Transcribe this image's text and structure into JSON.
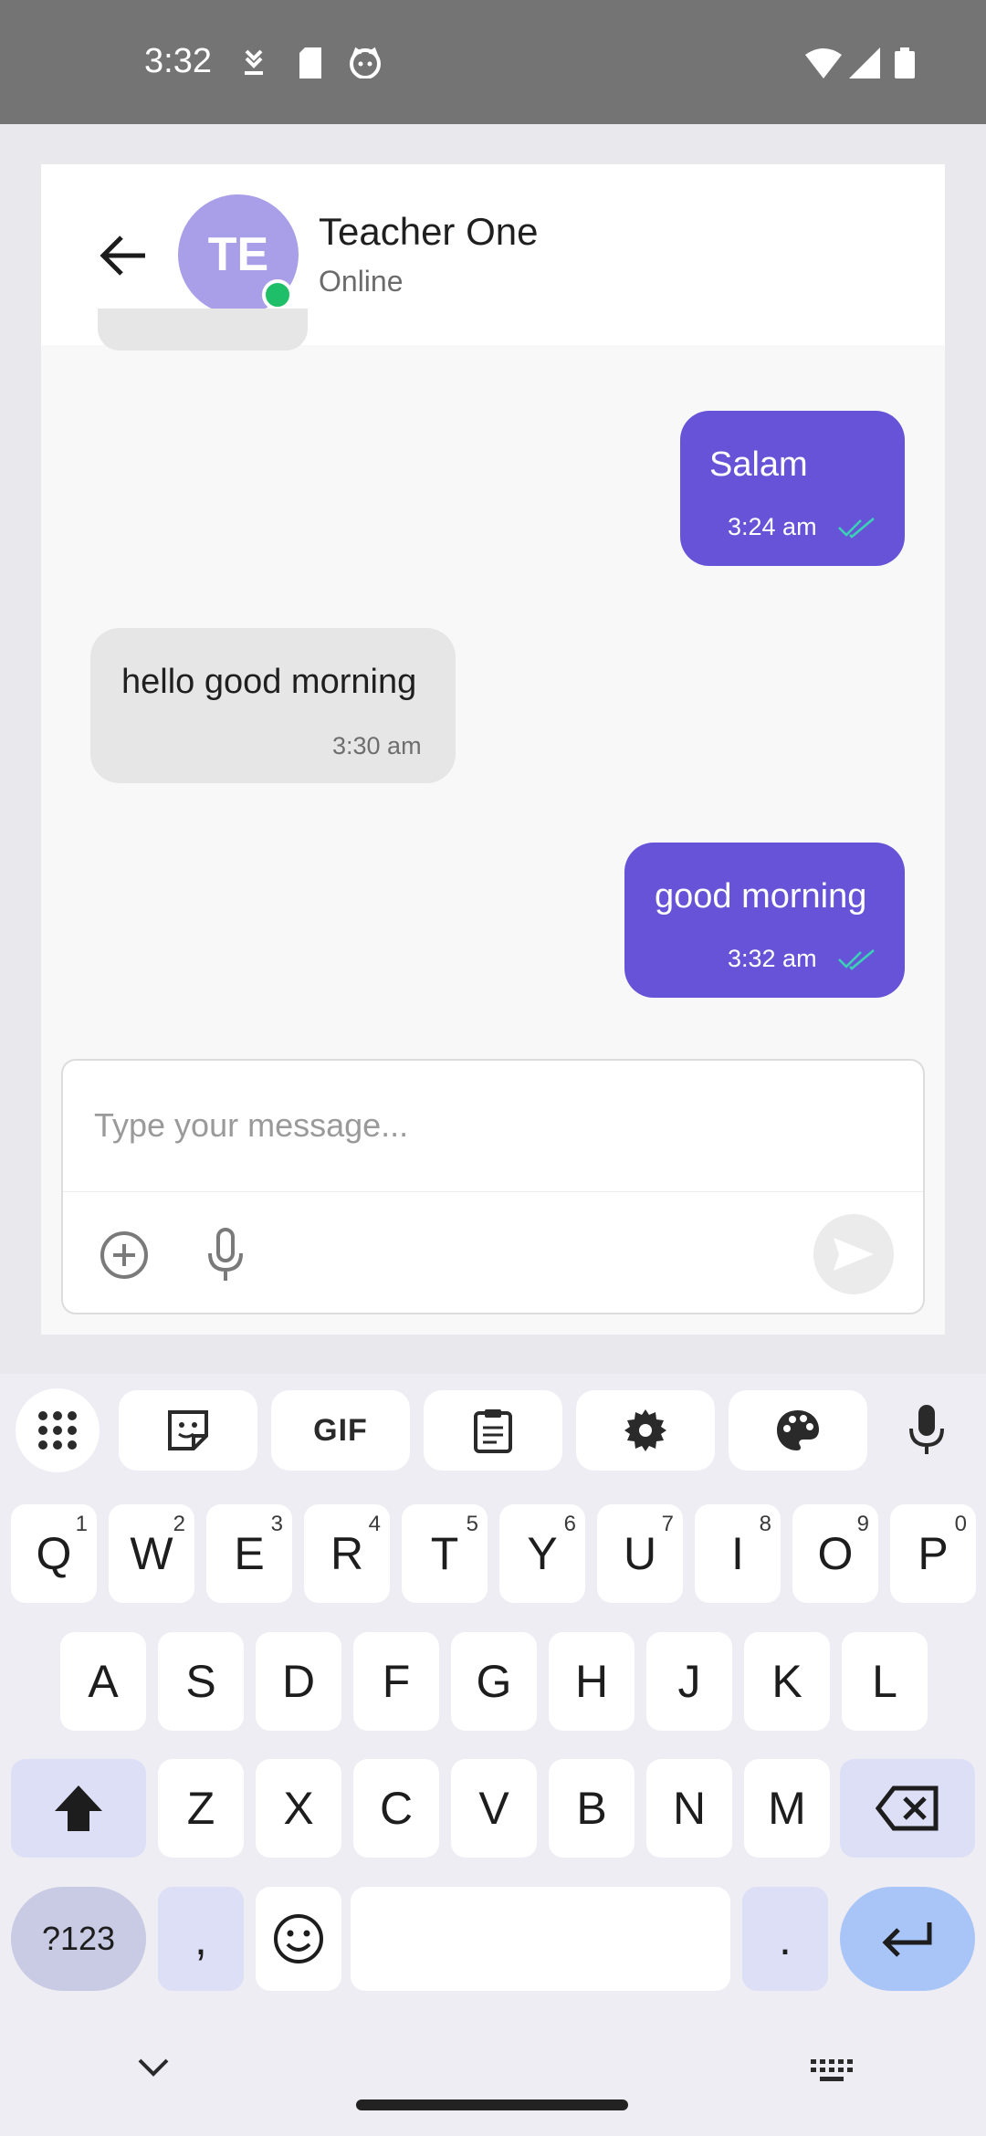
{
  "status_bar": {
    "time": "3:32",
    "left_icons": [
      "download-done-icon",
      "sd-card-icon",
      "cat-face-icon"
    ],
    "right_icons": [
      "wifi-icon",
      "cell-signal-icon",
      "battery-icon"
    ]
  },
  "header": {
    "back_icon": "arrow-left-icon",
    "avatar_initials": "TE",
    "name": "Teacher One",
    "status": "Online"
  },
  "messages": [
    {
      "direction": "outgoing",
      "text": "Salam",
      "time": "3:24 am",
      "status_icon": "double-check-icon"
    },
    {
      "direction": "incoming",
      "text": "hello good morning",
      "time": "3:30 am"
    },
    {
      "direction": "outgoing",
      "text": "good morning",
      "time": "3:32 am",
      "status_icon": "double-check-icon"
    }
  ],
  "composer": {
    "placeholder": "Type your message...",
    "value": "",
    "icons": [
      "add-circle-icon",
      "microphone-icon",
      "send-icon"
    ]
  },
  "keyboard": {
    "toolbar": [
      "apps-grid-icon",
      "sticker-icon",
      "GIF",
      "clipboard-icon",
      "settings-gear-icon",
      "palette-icon",
      "voice-mic-icon"
    ],
    "gif_label": "GIF",
    "row1": [
      {
        "key": "Q",
        "hint": "1"
      },
      {
        "key": "W",
        "hint": "2"
      },
      {
        "key": "E",
        "hint": "3"
      },
      {
        "key": "R",
        "hint": "4"
      },
      {
        "key": "T",
        "hint": "5"
      },
      {
        "key": "Y",
        "hint": "6"
      },
      {
        "key": "U",
        "hint": "7"
      },
      {
        "key": "I",
        "hint": "8"
      },
      {
        "key": "O",
        "hint": "9"
      },
      {
        "key": "P",
        "hint": "0"
      }
    ],
    "row2": [
      "A",
      "S",
      "D",
      "F",
      "G",
      "H",
      "J",
      "K",
      "L"
    ],
    "row3": [
      "Z",
      "X",
      "C",
      "V",
      "B",
      "N",
      "M"
    ],
    "symbols_label": "?123",
    "comma_label": ",",
    "period_label": ".",
    "special_icons": [
      "shift-icon",
      "backspace-icon",
      "emoji-icon",
      "enter-icon"
    ]
  },
  "nav_bar": {
    "icons": [
      "hide-keyboard-chevron-icon",
      "keyboard-switch-icon"
    ]
  },
  "colors": {
    "status_bar": "#747474",
    "outgoing_bubble": "#6753d8",
    "incoming_bubble": "#e6e6e6",
    "avatar": "#a99ee8",
    "online_dot": "#1fbf6a",
    "read_ticks": "#3ad4b4",
    "enter_key": "#a9c4f7"
  }
}
